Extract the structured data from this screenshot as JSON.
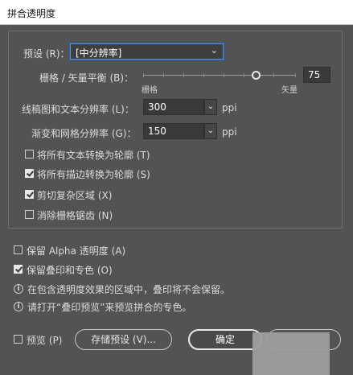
{
  "window": {
    "title": "拼合透明度"
  },
  "preset": {
    "label": "预设 (R)：",
    "value": "[中分辨率]"
  },
  "raster_vector": {
    "label": "栅格 / 矢量平衡 (B)：",
    "value": "75",
    "level": 75,
    "min_label": "栅格",
    "max_label": "矢量"
  },
  "line_art": {
    "label": "线稿图和文本分辨率 (L)：",
    "value": "300",
    "unit": "ppi"
  },
  "gradient_mesh": {
    "label": "渐变和网格分辨率 (G)：",
    "value": "150",
    "unit": "ppi"
  },
  "options": [
    {
      "label": "将所有文本转换为轮廓 (T)",
      "checked": false
    },
    {
      "label": "将所有描边转换为轮廓 (S)",
      "checked": true
    },
    {
      "label": "剪切复杂区域 (X)",
      "checked": true
    },
    {
      "label": "消除栅格锯齿 (N)",
      "checked": false
    }
  ],
  "preserve_alpha": {
    "label": "保留 Alpha 透明度 (A)",
    "checked": false
  },
  "preserve_overprint": {
    "label": "保留叠印和专色 (O)",
    "checked": true
  },
  "info": [
    "在包含透明度效果的区域中，叠印将不会保留。",
    "请打开“叠印预览”来预览拼合的专色。"
  ],
  "footer": {
    "preview_label": "预览 (P)",
    "preview_checked": false,
    "save_preset_label": "存储预设 (V)...",
    "ok_label": "确定"
  },
  "icons": {
    "info": "info-circle-icon",
    "dropdown": "chevron-down-icon"
  }
}
